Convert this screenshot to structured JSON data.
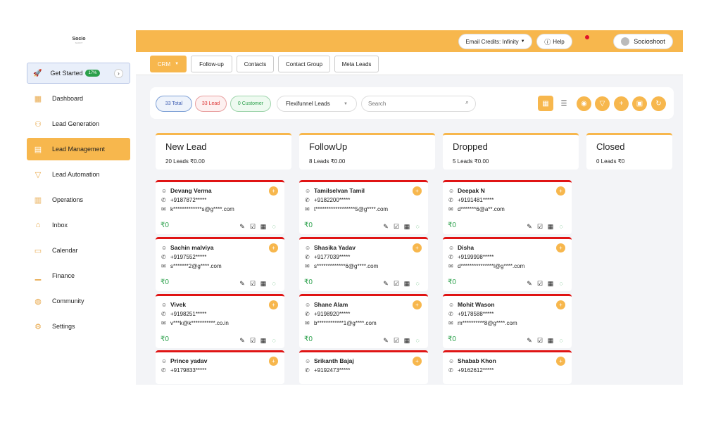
{
  "app": {
    "logo_text": "Socio",
    "logo_sub": "SHOOT"
  },
  "sidebar": {
    "get_started": {
      "label": "Get Started",
      "badge": "17%"
    },
    "items": [
      {
        "label": "Dashboard",
        "icon": "dashboard-icon"
      },
      {
        "label": "Lead Generation",
        "icon": "people-icon"
      },
      {
        "label": "Lead Management",
        "icon": "folder-icon",
        "active": true
      },
      {
        "label": "Lead Automation",
        "icon": "funnel-icon"
      },
      {
        "label": "Operations",
        "icon": "document-icon"
      },
      {
        "label": "Inbox",
        "icon": "inbox-icon"
      },
      {
        "label": "Calendar",
        "icon": "calendar-icon"
      },
      {
        "label": "Finance",
        "icon": "chart-icon"
      },
      {
        "label": "Community",
        "icon": "globe-icon"
      },
      {
        "label": "Settings",
        "icon": "gear-icon"
      }
    ]
  },
  "topbar": {
    "email_credits": "Email Credits: Infinity",
    "help": "Help",
    "user": "Socioshoot"
  },
  "tabs": [
    "CRM",
    "Follow-up",
    "Contacts",
    "Contact Group",
    "Meta Leads"
  ],
  "filters": {
    "total": "33 Total",
    "lead": "33 Lead",
    "customer": "0 Customer",
    "source": "Flexifunnel Leads",
    "search_placeholder": "Search"
  },
  "columns": [
    {
      "title": "New Lead",
      "summary": "20 Leads ₹0.00"
    },
    {
      "title": "FollowUp",
      "summary": "8 Leads ₹0.00"
    },
    {
      "title": "Dropped",
      "summary": "5 Leads ₹0.00"
    },
    {
      "title": "Closed",
      "summary": "0 Leads ₹0"
    }
  ],
  "leads": [
    [
      {
        "name": "Devang Verma",
        "phone": "+9187872*****",
        "email": "k*************s@g****.com",
        "amount": "₹0"
      },
      {
        "name": "Sachin malviya",
        "phone": "+9197552*****",
        "email": "s*******2@g****.com",
        "amount": "₹0"
      },
      {
        "name": "Vivek",
        "phone": "+9198251*****",
        "email": "v***k@k***********.co.in",
        "amount": "₹0"
      },
      {
        "name": "Prince yadav",
        "phone": "+9179833*****",
        "email": "",
        "amount": ""
      }
    ],
    [
      {
        "name": "Tamilselvan Tamil",
        "phone": "+9182200*****",
        "email": "t******************5@g****.com",
        "amount": "₹0"
      },
      {
        "name": "Shasika Yadav",
        "phone": "+9177039*****",
        "email": "s*************6@g****.com",
        "amount": "₹0"
      },
      {
        "name": "Shane Alam",
        "phone": "+9198920*****",
        "email": "b************1@g****.com",
        "amount": "₹0"
      },
      {
        "name": "Srikanth Bajaj",
        "phone": "+9192473*****",
        "email": "",
        "amount": ""
      }
    ],
    [
      {
        "name": "Deepak N",
        "phone": "+9191481*****",
        "email": "d*******6@a**.com",
        "amount": "₹0"
      },
      {
        "name": "Disha",
        "phone": "+9199998*****",
        "email": "d***************l@g****.com",
        "amount": "₹0"
      },
      {
        "name": "Mohit Wason",
        "phone": "+9178588*****",
        "email": "m**********8@g****.com",
        "amount": "₹0"
      },
      {
        "name": "Shabab Khon",
        "phone": "+9162612*****",
        "email": "",
        "amount": ""
      }
    ]
  ],
  "colors": {
    "accent": "#f7b74d",
    "danger": "#e01414",
    "success": "#2aa04a"
  }
}
